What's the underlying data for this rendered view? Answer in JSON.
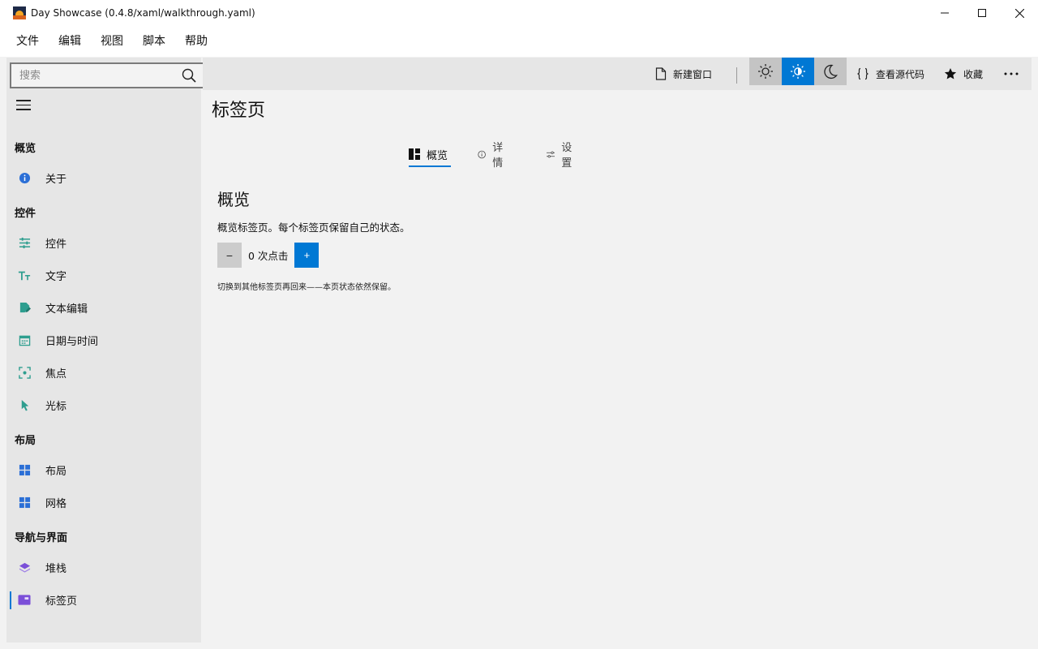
{
  "window": {
    "title": "Day Showcase (0.4.8/xaml/walkthrough.yaml)"
  },
  "menu": [
    "文件",
    "编辑",
    "视图",
    "脚本",
    "帮助"
  ],
  "search": {
    "placeholder": "搜索",
    "value": ""
  },
  "nav": {
    "sections": [
      {
        "label": "概览",
        "items": [
          {
            "label": "关于",
            "icon": "info-icon"
          }
        ]
      },
      {
        "label": "控件",
        "items": [
          {
            "label": "控件",
            "icon": "sliders-icon"
          },
          {
            "label": "文字",
            "icon": "text-size-icon"
          },
          {
            "label": "文本编辑",
            "icon": "edit-document-icon"
          },
          {
            "label": "日期与时间",
            "icon": "calendar-icon"
          },
          {
            "label": "焦点",
            "icon": "focus-icon"
          },
          {
            "label": "光标",
            "icon": "cursor-icon"
          }
        ]
      },
      {
        "label": "布局",
        "items": [
          {
            "label": "布局",
            "icon": "layout-icon"
          },
          {
            "label": "网格",
            "icon": "grid-icon"
          }
        ]
      },
      {
        "label": "导航与界面",
        "items": [
          {
            "label": "堆栈",
            "icon": "stack-icon"
          },
          {
            "label": "标签页",
            "icon": "tab-icon",
            "selected": true
          }
        ]
      }
    ]
  },
  "toolbar": {
    "new_window": "新建窗口",
    "view_source": "查看源代码",
    "favorite": "收藏",
    "theme": "system"
  },
  "page": {
    "title": "标签页",
    "tabs": [
      {
        "label": "概览",
        "icon": "dashboard-icon",
        "active": true
      },
      {
        "label": "详情",
        "icon": "info-outline-icon"
      },
      {
        "label": "设置",
        "icon": "settings-sliders-icon"
      }
    ],
    "section_heading": "概览",
    "description": "概览标签页。每个标签页保留自己的状态。",
    "counter": {
      "decrement": "−",
      "text": "0 次点击",
      "increment": "+"
    },
    "note": "切换到其他标签页再回来——本页状态依然保留。"
  },
  "colors": {
    "accent": "#0078d4",
    "sidebar_bg": "#e6e6e6",
    "content_bg": "#f2f2f2",
    "teal_icon": "#2e9e8f",
    "blue_icon": "#2b6fd6",
    "purple_icon": "#7b4fd8"
  }
}
